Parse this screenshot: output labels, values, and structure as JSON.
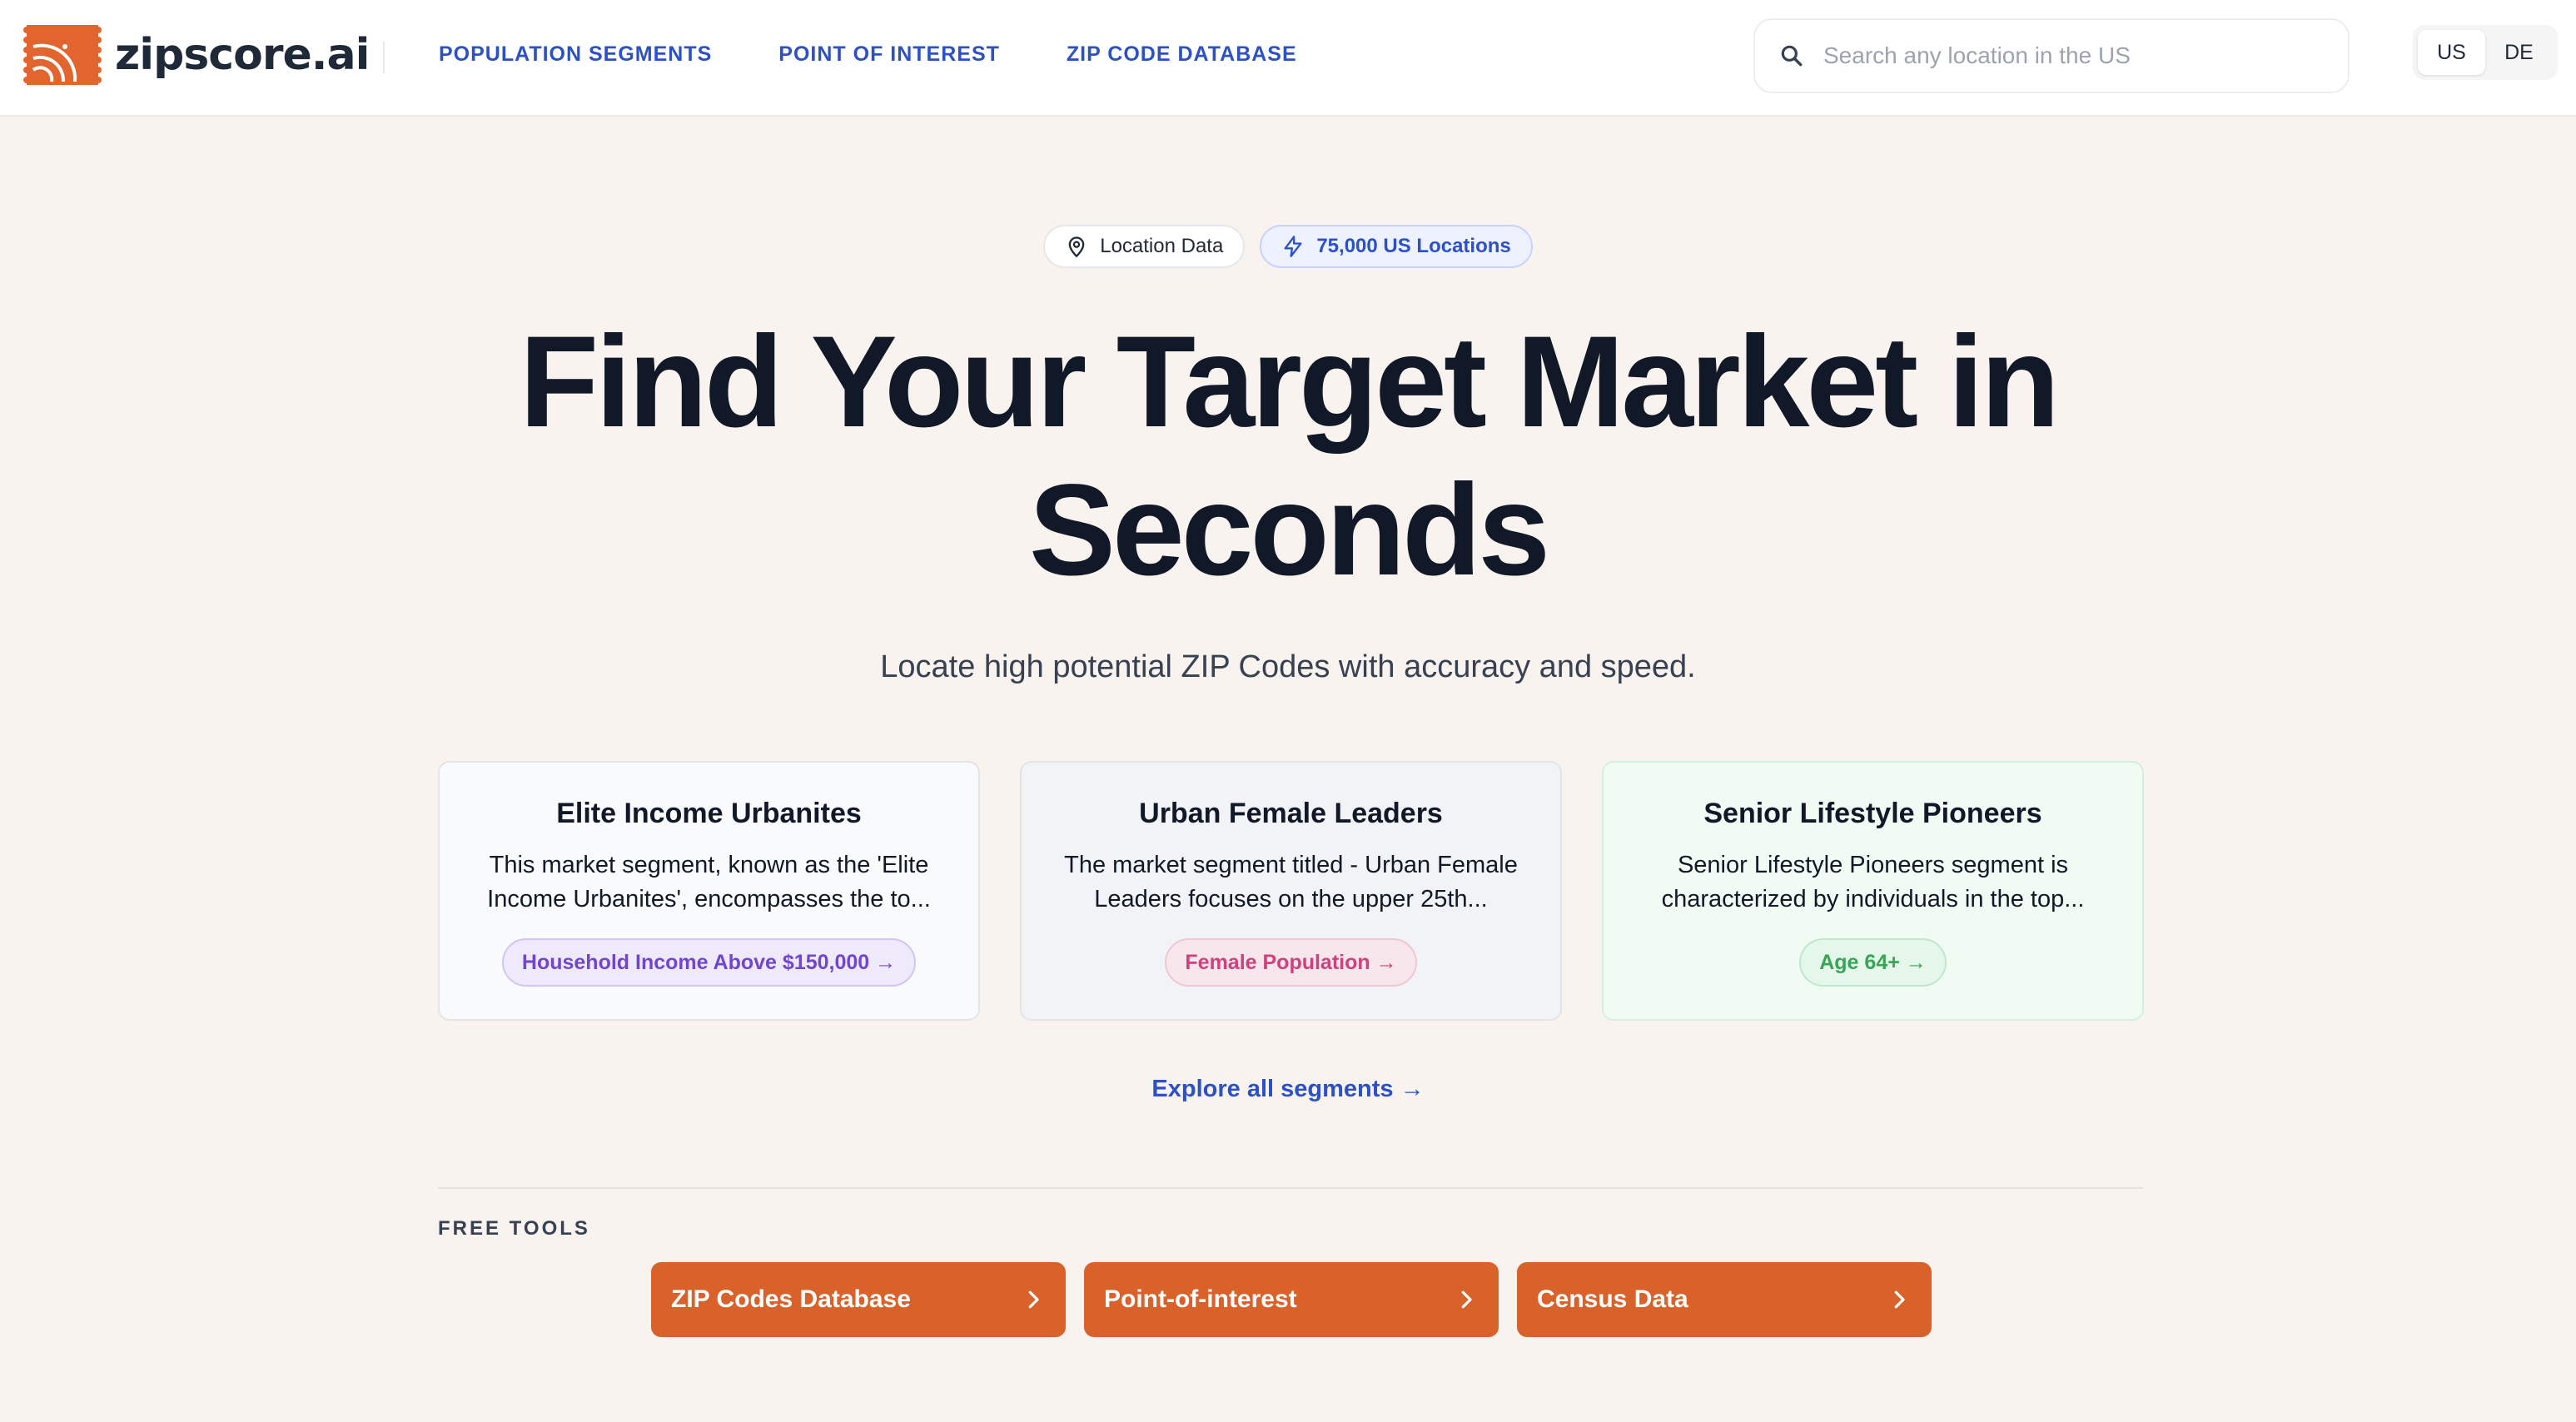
{
  "header": {
    "brand": "zipscore.ai",
    "brand_color": "#e2652f",
    "nav": [
      {
        "label": "POPULATION SEGMENTS"
      },
      {
        "label": "POINT OF INTEREST"
      },
      {
        "label": "ZIP CODE DATABASE"
      }
    ],
    "search": {
      "placeholder": "Search any location in the US",
      "icon": "search-icon"
    },
    "region": {
      "options": [
        "US",
        "DE"
      ],
      "selected": "US"
    }
  },
  "badges": [
    {
      "label": "Location Data",
      "icon": "map-pin-icon"
    },
    {
      "label": "75,000 US Locations",
      "icon": "lightning-icon"
    }
  ],
  "hero": {
    "title_line1": "Find Your Target Market in",
    "title_line2": "Seconds",
    "subtitle": "Locate high potential ZIP Codes with accuracy and speed."
  },
  "segments": [
    {
      "title": "Elite Income Urbanites",
      "description": "This market segment, known as the 'Elite Income Urbanites', encompasses the to...",
      "tag": "Household Income Above $150,000 →",
      "tag_color": "#7046d1"
    },
    {
      "title": "Urban Female Leaders",
      "description": "The market segment titled - Urban Female Leaders focuses on the upper 25th...",
      "tag": "Female Population →",
      "tag_color": "#d0407d"
    },
    {
      "title": "Senior Lifestyle Pioneers",
      "description": "Senior Lifestyle Pioneers segment is characterized by individuals in the top...",
      "tag": "Age 64+ →",
      "tag_color": "#37a456"
    }
  ],
  "explore_link": "Explore all segments →",
  "free_tools": {
    "label": "FREE TOOLS",
    "items": [
      {
        "label": "ZIP Codes Database"
      },
      {
        "label": "Point-of-interest"
      },
      {
        "label": "Census Data"
      }
    ],
    "button_color": "#d9622b"
  }
}
